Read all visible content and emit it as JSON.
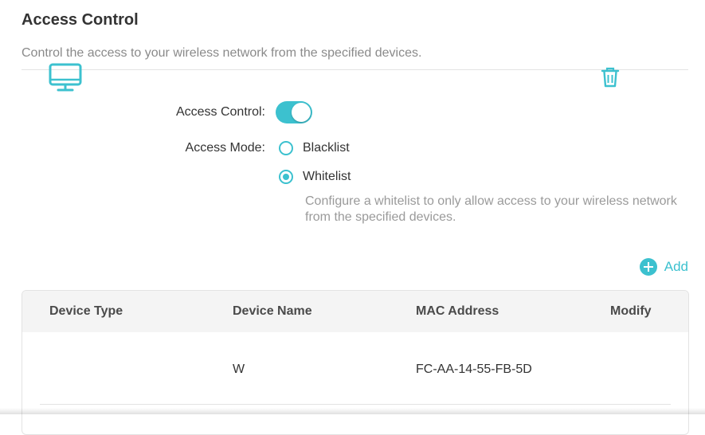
{
  "header": {
    "title": "Access Control",
    "description": "Control the access to your wireless network from the specified devices."
  },
  "settings": {
    "access_control_label": "Access Control:",
    "access_control_enabled": true,
    "access_mode_label": "Access Mode:",
    "modes": [
      {
        "label": "Blacklist",
        "selected": false
      },
      {
        "label": "Whitelist",
        "selected": true
      }
    ],
    "whitelist_hint": "Configure a whitelist to only allow access to your wireless network from the specified devices."
  },
  "toolbar": {
    "add_label": "Add"
  },
  "table": {
    "headers": [
      "Device Type",
      "Device Name",
      "MAC Address",
      "Modify"
    ],
    "rows": [
      {
        "device_type_icon": "monitor-icon",
        "device_name": "W",
        "mac_address": "FC-AA-14-55-FB-5D",
        "modify_icon": "trash-icon"
      }
    ]
  },
  "colors": {
    "accent": "#3cc1cf",
    "header_bg": "#f4f4f4",
    "muted_text": "#8a8a8a"
  }
}
